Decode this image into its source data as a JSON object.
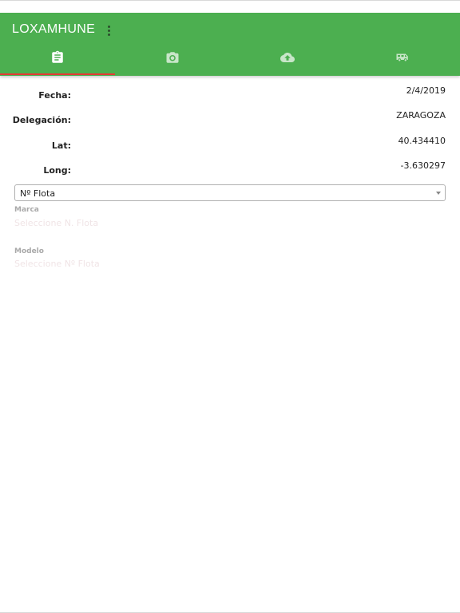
{
  "app": {
    "title": "LOXAMHUNE"
  },
  "colors": {
    "appbar": "#4caf50",
    "tab_indicator": "#e53935",
    "icon_active": "#ffffff",
    "icon_inactive": "#c8e6c9"
  },
  "tabs": [
    {
      "name": "form",
      "icon": "clipboard-icon",
      "active": true
    },
    {
      "name": "photos",
      "icon": "camera-icon",
      "active": false
    },
    {
      "name": "upload",
      "icon": "cloud-upload-icon",
      "active": false
    },
    {
      "name": "vehicle",
      "icon": "van-icon",
      "active": false
    }
  ],
  "info": {
    "fecha_label": "Fecha:",
    "fecha_value": "2/4/2019",
    "delegacion_label": "Delegación:",
    "delegacion_value": "ZARAGOZA",
    "lat_label": "Lat:",
    "lat_value": "40.434410",
    "long_label": "Long:",
    "long_value": "-3.630297"
  },
  "flota_select": {
    "selected": "Nº Flota"
  },
  "marca": {
    "label": "Marca",
    "placeholder": "Seleccione N. Flota"
  },
  "modelo": {
    "label": "Modelo",
    "placeholder": "Seleccione Nº Flota"
  }
}
